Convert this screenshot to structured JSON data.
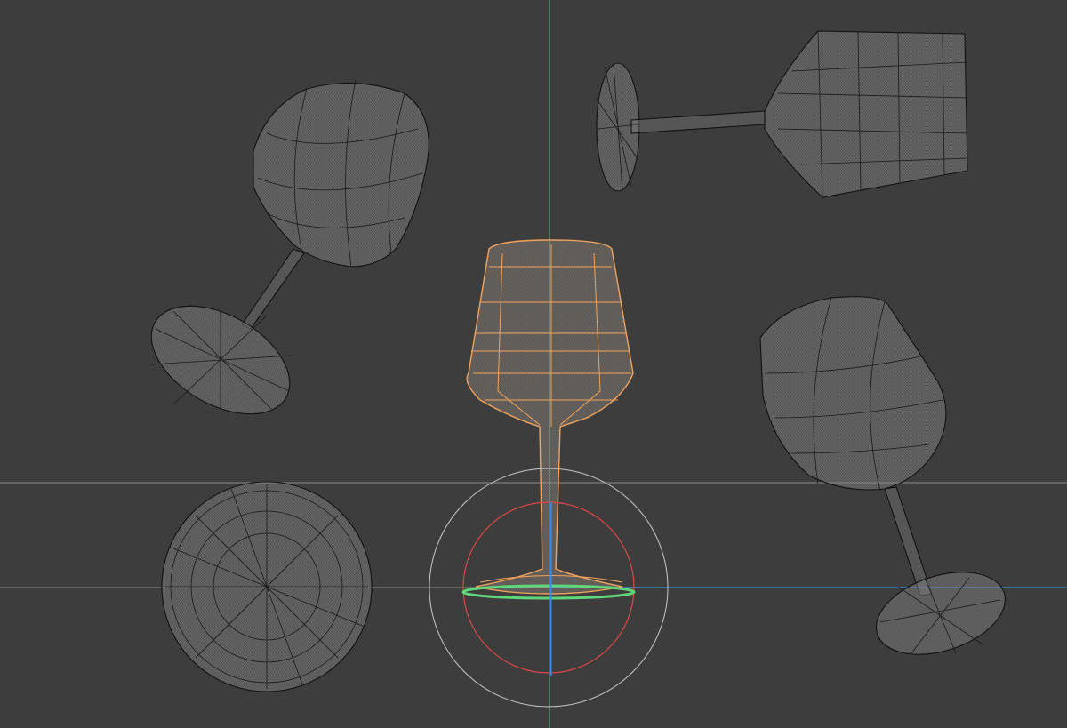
{
  "viewport": {
    "background": "#3d3d3d",
    "grid_line_color": "#8a8a8a",
    "y_axis_color": "#5fbf8f",
    "x_axis_color": "#3c8ce6",
    "selection_color": "#f2a45c"
  },
  "scene": {
    "objects": [
      {
        "name": "wine-glass-tilted-left",
        "selected": false
      },
      {
        "name": "wine-glass-horizontal",
        "selected": false
      },
      {
        "name": "wine-glass-upright",
        "selected": true
      },
      {
        "name": "wine-glass-tilted-right",
        "selected": false
      },
      {
        "name": "wine-glass-base-top-view",
        "selected": false
      }
    ]
  },
  "gizmo": {
    "type": "rotate",
    "ring_colors": {
      "outer": "#c8c8c8",
      "x": "#e04646",
      "y": "#5fd67a",
      "z": "#3c8ce6"
    }
  }
}
